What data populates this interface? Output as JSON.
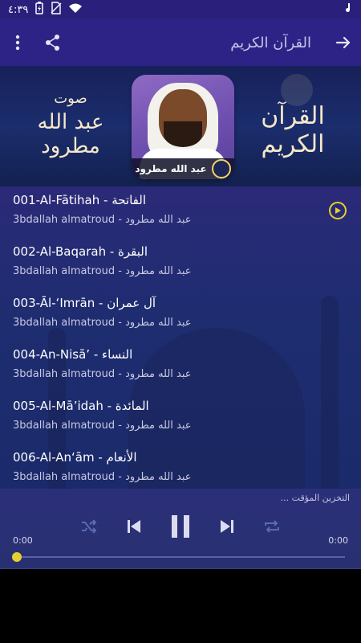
{
  "status": {
    "time": "٤:٣٩"
  },
  "appbar": {
    "title": "القرآن الكريم"
  },
  "banner": {
    "left_small": "صوت",
    "left_big": "عبد الله مطرود",
    "right_text": "القرآن الكريم",
    "caption": "عبد الله مطرود"
  },
  "tracks": [
    {
      "title": "001-Al-Fātihah - الفاتحة",
      "subtitle": "3bdallah almatroud - عبد الله مطرود",
      "playing": true
    },
    {
      "title": "002-Al-Baqarah - البقرة",
      "subtitle": "3bdallah almatroud - عبد الله مطرود",
      "playing": false
    },
    {
      "title": "003-Āl-ʻImrān - آل عمران",
      "subtitle": "3bdallah almatroud - عبد الله مطرود",
      "playing": false
    },
    {
      "title": "004-An-Nisā’ - النساء",
      "subtitle": "3bdallah almatroud - عبد الله مطرود",
      "playing": false
    },
    {
      "title": "005-Al-Mā’idah - المائدة",
      "subtitle": "3bdallah almatroud - عبد الله مطرود",
      "playing": false
    },
    {
      "title": "006-Al-An‘ām - الأنعام",
      "subtitle": "3bdallah almatroud - عبد الله مطرود",
      "playing": false
    }
  ],
  "player": {
    "buffering_text": "التخزين المؤقت ...",
    "time_start": "0:00",
    "time_end": "0:00",
    "progress": 0
  },
  "colors": {
    "accent": "#e6cf32",
    "appbar": "#2d2386"
  }
}
